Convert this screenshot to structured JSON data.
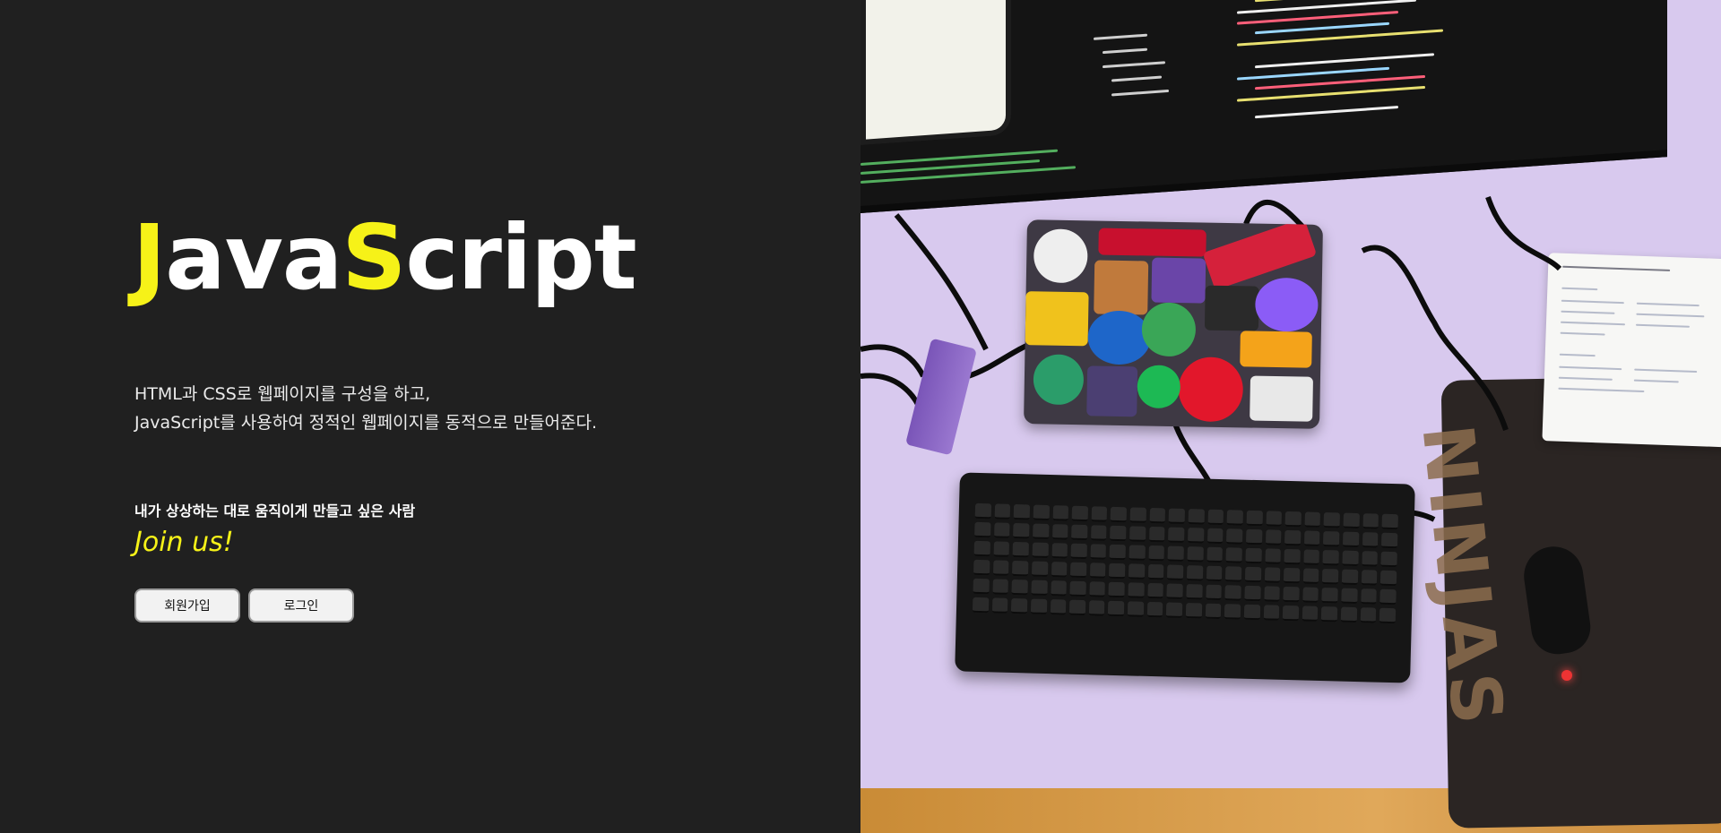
{
  "hero": {
    "logo_part1": "J",
    "logo_part2": "ava",
    "logo_part3": "S",
    "logo_part4": "cript",
    "description_line1": "HTML과 CSS로 웹페이지를 구성을 하고,",
    "description_line2": "JavaScript를 사용하여 정적인 웹페이지를 동적으로 만들어준다.",
    "tagline": "내가 상상하는 대로 움직이게 만들고 싶은 사람",
    "cta_text": "Join us!",
    "signup_label": "회원가입",
    "login_label": "로그인"
  },
  "colors": {
    "background": "#202020",
    "accent": "#f6f218",
    "text": "#ffffff",
    "button_bg": "#f2f2f2"
  },
  "image": {
    "subject": "desk-setup-photo",
    "icons": [
      "monitor",
      "laptop-with-stickers",
      "keyboard",
      "mouse",
      "mousepad",
      "notebook"
    ]
  }
}
